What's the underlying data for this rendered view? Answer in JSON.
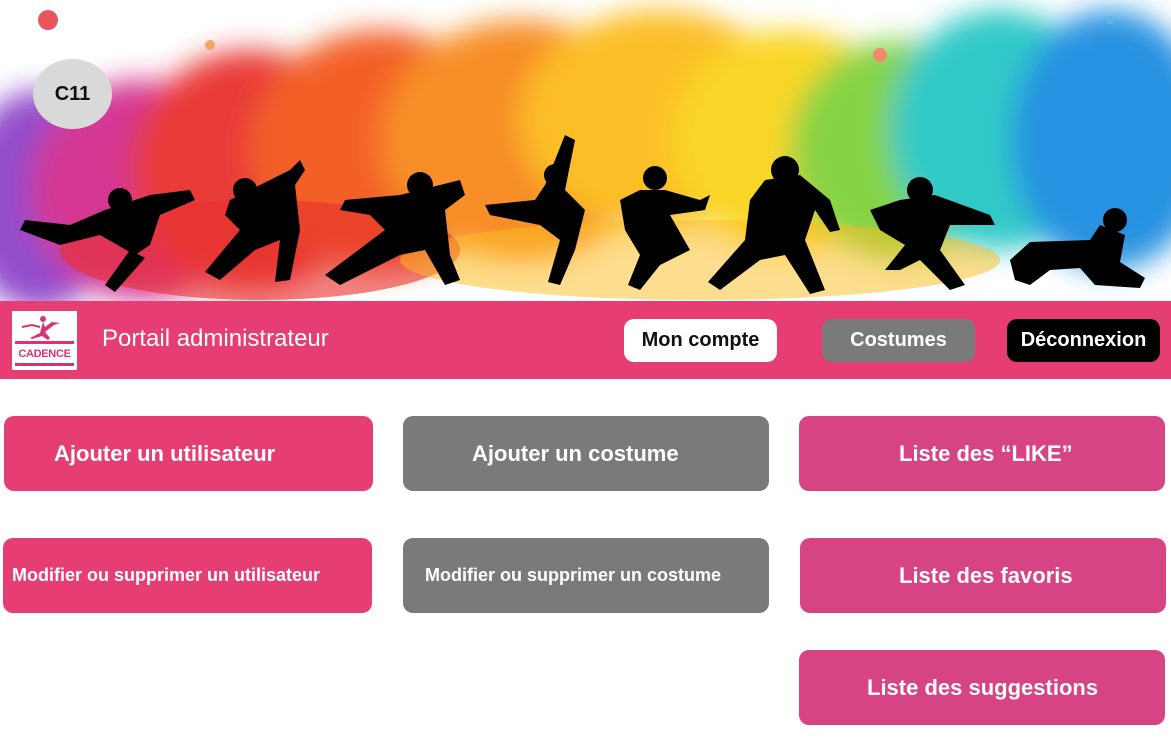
{
  "badge": {
    "label": "C11"
  },
  "header": {
    "logo_text": "CADENCE",
    "title": "Portail administrateur",
    "nav": {
      "account": "Mon compte",
      "costumes": "Costumes",
      "logout": "Déconnexion"
    }
  },
  "actions": {
    "add_user": "Ajouter un utilisateur",
    "add_costume": "Ajouter un costume",
    "likes_list": "Liste des “LIKE”",
    "edit_user": "Modifier ou supprimer un utilisateur",
    "edit_costume": "Modifier ou supprimer un costume",
    "favorites_list": "Liste des favoris",
    "suggestions_list": "Liste des suggestions"
  },
  "colors": {
    "brand_pink": "#e63e73",
    "grey": "#7a7a7a",
    "magenta": "#d64484",
    "black": "#000000"
  }
}
